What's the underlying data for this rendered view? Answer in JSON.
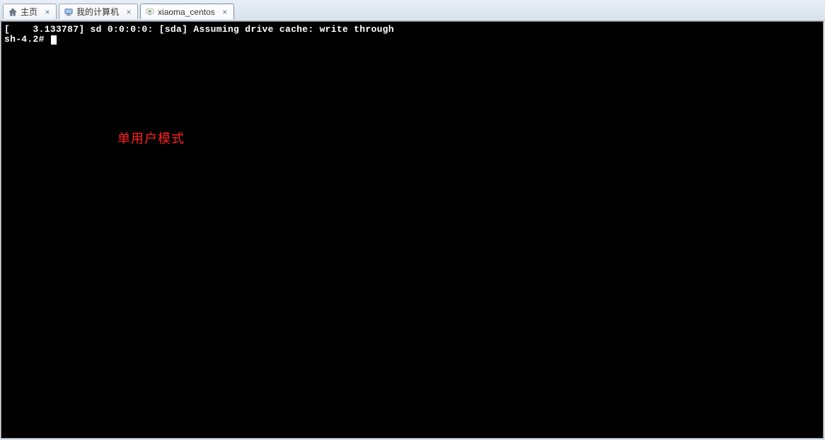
{
  "tabs": [
    {
      "label": "主页",
      "icon": "home-icon"
    },
    {
      "label": "我的计算机",
      "icon": "monitor-icon"
    },
    {
      "label": "xiaoma_centos",
      "icon": "vm-power-icon",
      "active": true
    }
  ],
  "terminal": {
    "line1": "[    3.133787] sd 0:0:0:0: [sda] Assuming drive cache: write through",
    "prompt": "sh-4.2#"
  },
  "overlay": {
    "text": "单用户模式"
  }
}
